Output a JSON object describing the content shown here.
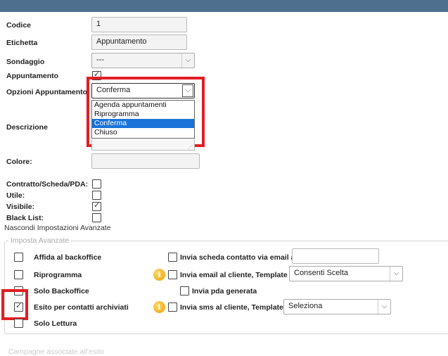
{
  "form": {
    "codice_label": "Codice",
    "codice_value": "1",
    "etichetta_label": "Etichetta",
    "etichetta_value": "Appuntamento",
    "sondaggio_label": "Sondaggio",
    "sondaggio_value": "---",
    "appuntamento_label": "Appuntamento",
    "appuntamento_checked": true,
    "opzioni_label": "Opzioni Appuntamento",
    "opzioni_value": "Conferma",
    "opzioni_options": [
      "Agenda appuntamenti",
      "Riprogramma",
      "Conferma",
      "Chiuso"
    ],
    "opzioni_selected_index": 2,
    "descrizione_label": "Descrizione",
    "colore_label": "Colore:",
    "contratto_label": "Contratto/Scheda/PDA:",
    "utile_label": "Utile:",
    "visibile_label": "Visibile:",
    "visibile_checked": true,
    "blacklist_label": "Black List:",
    "toggle_link": "Nascondi Impostazioni Avanzate"
  },
  "advanced": {
    "legend": "Imposta Avanzate",
    "affida_label": "Affida al backoffice",
    "riprogramma_label": "Riprogramma",
    "solo_backoffice_label": "Solo Backoffice",
    "esito_label": "Esito per contatti archiviati",
    "esito_checked": true,
    "solo_lettura_label": "Solo Lettura",
    "invia_scheda_label": "Invia scheda contatto via email a",
    "invia_email_label": "Invia email al cliente, Template",
    "invia_email_template": "Consenti Scelta",
    "invia_pda_label": "Invia pda generata",
    "invia_sms_label": "Invia sms al cliente, Template",
    "invia_sms_template": "Seleziona"
  },
  "footer_partial": "Campagne associate all'esito",
  "colors": {
    "header": "#4f6f8f",
    "highlight": "#e21d24",
    "selected_option": "#1a73d9"
  }
}
